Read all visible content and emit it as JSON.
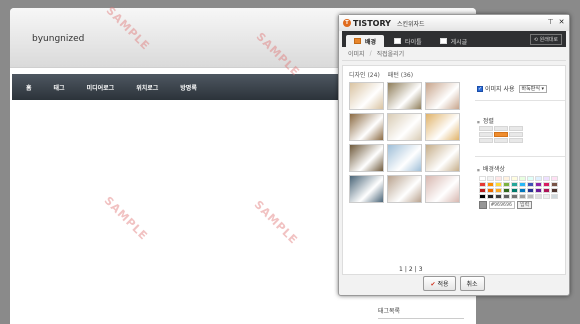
{
  "blog": {
    "title": "byungnized",
    "nav": [
      "홈",
      "태그",
      "미디어로그",
      "위치로그",
      "방명록"
    ],
    "sidebar_heading": "태그목록",
    "watermark": "SAMPLE"
  },
  "wizard": {
    "brand": "TISTORY",
    "brand_icon": "T",
    "subtitle": "스킨위자드",
    "pin_icon": "pin-icon",
    "close_icon": "close-icon",
    "tabs": [
      {
        "label": "배경",
        "active": true
      },
      {
        "label": "타이틀",
        "active": false
      },
      {
        "label": "게시글",
        "active": false
      }
    ],
    "restore_label": "원래대로",
    "subnav": [
      "이미지",
      "직접올리기"
    ],
    "source_tabs": [
      "디자인 (24)",
      "패턴 (36)"
    ],
    "thumbnails": [
      "#d9c3a1",
      "#8f7e5a",
      "#c8a58c",
      "#8b6a42",
      "#d9ccb5",
      "#e0b36a",
      "#6f5a3c",
      "#9fbfd8",
      "#c6ae8a",
      "#4a6578",
      "#b9a38f",
      "#d8b8b0"
    ],
    "pages": [
      "1",
      "2",
      "3"
    ],
    "image_use_label": "이미지 사용",
    "image_mode": "바둑판식",
    "align_label": "정렬",
    "bgcolor_label": "배경색상",
    "palette": [
      "#ffffff",
      "#f2f2f2",
      "#ffe6e6",
      "#fff2e0",
      "#fffde0",
      "#e8ffe0",
      "#e0fff8",
      "#e0f0ff",
      "#eee0ff",
      "#ffe0f4",
      "#e53935",
      "#fb8c00",
      "#fdd835",
      "#7cb342",
      "#26a69a",
      "#29b6f6",
      "#3f51b5",
      "#8e24aa",
      "#d81b60",
      "#795548",
      "#b71c1c",
      "#ef6c00",
      "#f9a825",
      "#33691e",
      "#00796b",
      "#0277bd",
      "#283593",
      "#6a1b9a",
      "#ad1457",
      "#4e342e",
      "#000000",
      "#212121",
      "#424242",
      "#616161",
      "#757575",
      "#9e9e9e",
      "#bdbdbd",
      "#e0e0e0",
      "#eeeeee",
      "#cfd8dc"
    ],
    "current_color": "#969696",
    "hex_value": "#969696",
    "apply_hex_label": "입력",
    "apply_label": "적용",
    "cancel_label": "취소"
  }
}
